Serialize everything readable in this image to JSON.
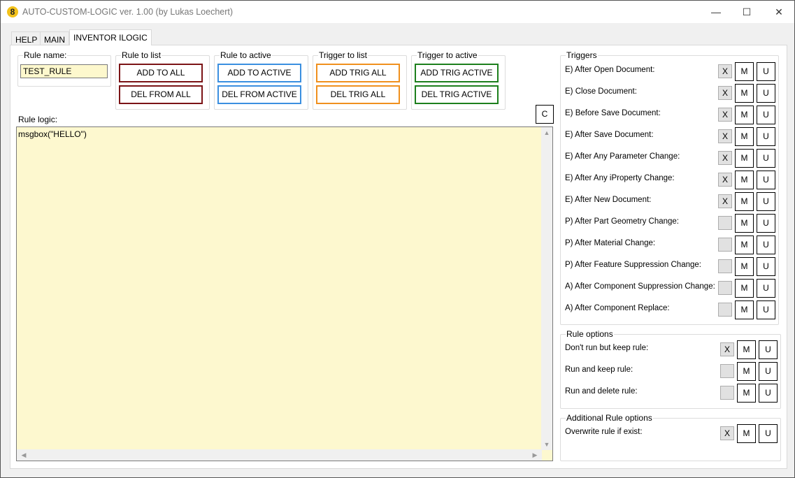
{
  "window": {
    "title": "AUTO-CUSTOM-LOGIC ver. 1.00 (by Lukas Loechert)",
    "minimize": "—",
    "maximize": "☐",
    "close": "✕",
    "icon_letter": "8"
  },
  "tabs": [
    {
      "label": "HELP"
    },
    {
      "label": "MAIN"
    },
    {
      "label": "INVENTOR ILOGIC",
      "active": true
    }
  ],
  "rule_name": {
    "label": "Rule name:",
    "value": "TEST_RULE"
  },
  "rule_to_list": {
    "label": "Rule to list",
    "add": "ADD TO ALL",
    "del": "DEL FROM ALL"
  },
  "rule_to_active": {
    "label": "Rule to active",
    "add": "ADD TO ACTIVE",
    "del": "DEL FROM ACTIVE"
  },
  "trigger_to_list": {
    "label": "Trigger to list",
    "add": "ADD TRIG ALL",
    "del": "DEL TRIG ALL"
  },
  "trigger_to_active": {
    "label": "Trigger to active",
    "add": "ADD TRIG ACTIVE",
    "del": "DEL TRIG ACTIVE"
  },
  "clear_button": "C",
  "rule_logic": {
    "label": "Rule logic:",
    "code": "msgbox(\"HELLO\")"
  },
  "triggers": {
    "label": "Triggers",
    "items": [
      {
        "label": "E) After Open Document:",
        "checked": "X"
      },
      {
        "label": "E) Close Document:",
        "checked": "X"
      },
      {
        "label": "E) Before Save Document:",
        "checked": "X"
      },
      {
        "label": "E) After Save Document:",
        "checked": "X"
      },
      {
        "label": "E) After Any Parameter Change:",
        "checked": "X"
      },
      {
        "label": "E) After Any iProperty Change:",
        "checked": "X"
      },
      {
        "label": "E) After New Document:",
        "checked": "X"
      },
      {
        "label": "P) After Part Geometry Change:",
        "checked": ""
      },
      {
        "label": "P) After Material Change:",
        "checked": ""
      },
      {
        "label": "P) After Feature Suppression Change:",
        "checked": ""
      },
      {
        "label": "A) After Component Suppression Change:",
        "checked": ""
      },
      {
        "label": "A) After Component Replace:",
        "checked": ""
      }
    ]
  },
  "rule_options": {
    "label": "Rule options",
    "items": [
      {
        "label": "Don't run but keep rule:",
        "checked": "X"
      },
      {
        "label": "Run and keep rule:",
        "checked": ""
      },
      {
        "label": "Run and delete rule:",
        "checked": ""
      }
    ]
  },
  "additional_options": {
    "label": "Additional Rule options",
    "items": [
      {
        "label": "Overwrite rule if exist:",
        "checked": "X"
      }
    ]
  },
  "m_label": "M",
  "u_label": "U",
  "colors": {
    "del_all": "#7b1416",
    "active": "#3b8fe0",
    "trig_all": "#f0901e",
    "trig_active": "#1d7f1d",
    "input_bg": "#fdf8cd"
  }
}
